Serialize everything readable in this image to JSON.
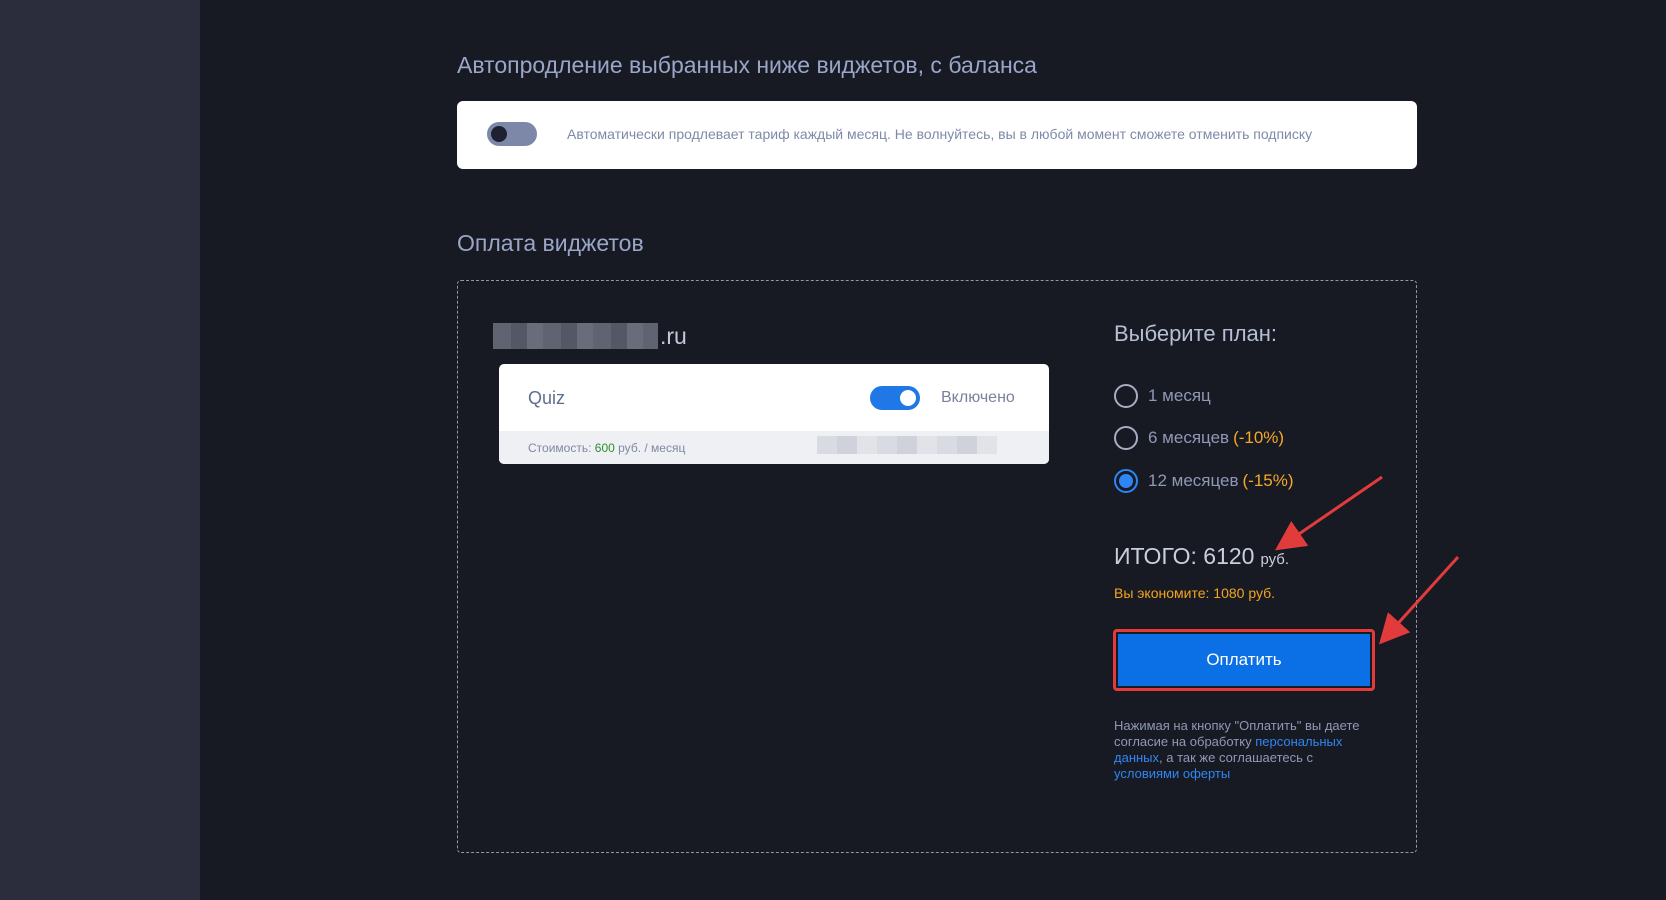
{
  "autorenew": {
    "title": "Автопродление выбранных ниже виджетов, с баланса",
    "description": "Автоматически продлевает тариф каждый месяц. Не волнуйтесь, вы в любой момент сможете отменить подписку"
  },
  "payment": {
    "title": "Оплата виджетов",
    "domain_suffix": ".ru",
    "widget": {
      "name": "Quiz",
      "status_label": "Включено",
      "cost_prefix": "Стоимость:",
      "cost_value": "600",
      "cost_suffix": "руб. / месяц"
    },
    "plan_title": "Выберите план:",
    "plans": [
      {
        "label": "1 месяц",
        "discount": ""
      },
      {
        "label": "6 месяцев",
        "discount": "(-10%)"
      },
      {
        "label": "12 месяцев",
        "discount": "(-15%)"
      }
    ],
    "selected_plan": 2,
    "total_label": "ИТОГО: 6120",
    "total_currency": "руб.",
    "economy": "Вы экономите: 1080 руб.",
    "pay_button": "Оплатить",
    "consent_text_1": "Нажимая на кнопку \"Оплатить\" вы даете согласие на обработку",
    "consent_link_1": "персональных данных",
    "consent_text_2": ", а так же соглашаетесь с",
    "consent_link_2": "условиями оферты"
  },
  "colors": {
    "accent": "#0b6fe6",
    "discount": "#f4a82a",
    "highlight": "#e23b3b"
  }
}
